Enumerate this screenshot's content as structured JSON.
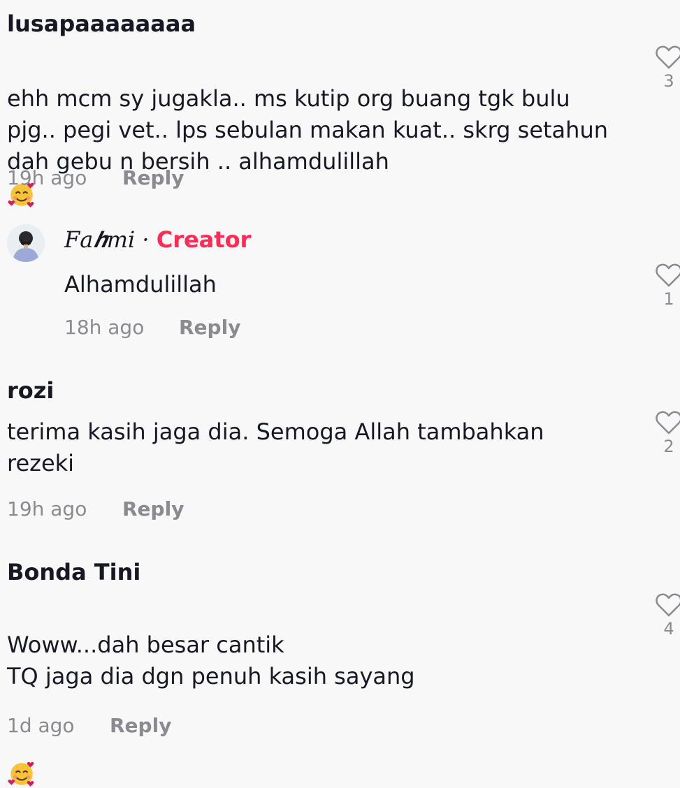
{
  "comments": [
    {
      "username": "lusapaaaaaaaa",
      "text": "ehh mcm sy jugakla.. ms kutip org buang tgk bulu\npjg.. pegi vet.. lps sebulan makan kuat.. skrg setahun\ndah gebu n bersih .. alhamdulillah",
      "emoji": "smiling-face-with-hearts",
      "time": "19h ago",
      "reply": "Reply",
      "likes": "3"
    },
    {
      "username": "𝐹𝑎𝒉𝑚𝑖",
      "separator": " · ",
      "badge": "Creator",
      "text": "Alhamdulillah",
      "time": "18h ago",
      "reply": "Reply",
      "likes": "1"
    },
    {
      "username": "rozi",
      "text": "terima kasih jaga dia. Semoga Allah tambahkan\nrezeki",
      "time": "19h ago",
      "reply": "Reply",
      "likes": "2"
    },
    {
      "username": "Bonda Tini",
      "text": "Woww...dah besar cantik\nTQ jaga dia dgn penuh kasih sayang",
      "emoji": "smiling-face-with-hearts",
      "time": "1d ago",
      "reply": "Reply",
      "likes": "4"
    }
  ],
  "colors": {
    "creator_badge": "#fe2c55",
    "secondary_text": "#8a8b91",
    "primary_text": "#161823"
  }
}
